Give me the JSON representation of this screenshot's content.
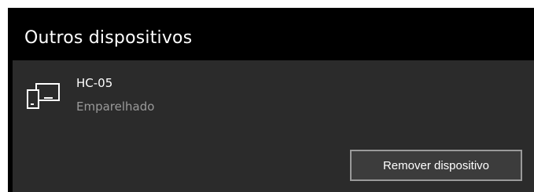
{
  "section": {
    "title": "Outros dispositivos"
  },
  "device": {
    "name": "HC-05",
    "status": "Emparelhado",
    "icon": "device-icon"
  },
  "actions": {
    "remove_label": "Remover dispositivo"
  },
  "colors": {
    "background": "#000000",
    "panel": "#2b2b2b",
    "text": "#ffffff",
    "secondary_text": "#9a9a9a",
    "button_border": "#9a9a9a"
  }
}
